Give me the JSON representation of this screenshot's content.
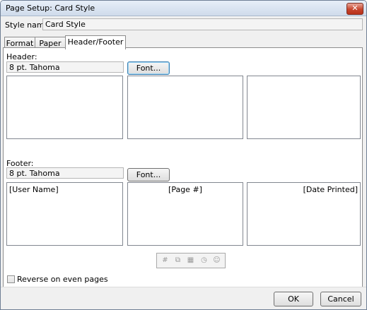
{
  "window": {
    "title": "Page Setup: Card Style",
    "close_glyph": "✕"
  },
  "style_name": {
    "label": "Style name:",
    "value": "Card Style"
  },
  "tabs": [
    {
      "label": "Format"
    },
    {
      "label": "Paper"
    },
    {
      "label": "Header/Footer",
      "active": true
    }
  ],
  "header": {
    "label": "Header:",
    "font_value": "8 pt. Tahoma",
    "font_button": "Font...",
    "left": "",
    "center": "",
    "right": ""
  },
  "footer": {
    "label": "Footer:",
    "font_value": "8 pt. Tahoma",
    "font_button": "Font...",
    "left": "[User Name]",
    "center": "[Page #]",
    "right": "[Date Printed]"
  },
  "toolbar": {
    "icons": [
      "insert-page-number-icon",
      "insert-total-pages-icon",
      "insert-date-icon",
      "insert-time-icon",
      "insert-user-name-icon"
    ]
  },
  "reverse_even_pages": {
    "label": "Reverse on even pages",
    "checked": false
  },
  "buttons": {
    "ok": "OK",
    "cancel": "Cancel"
  }
}
